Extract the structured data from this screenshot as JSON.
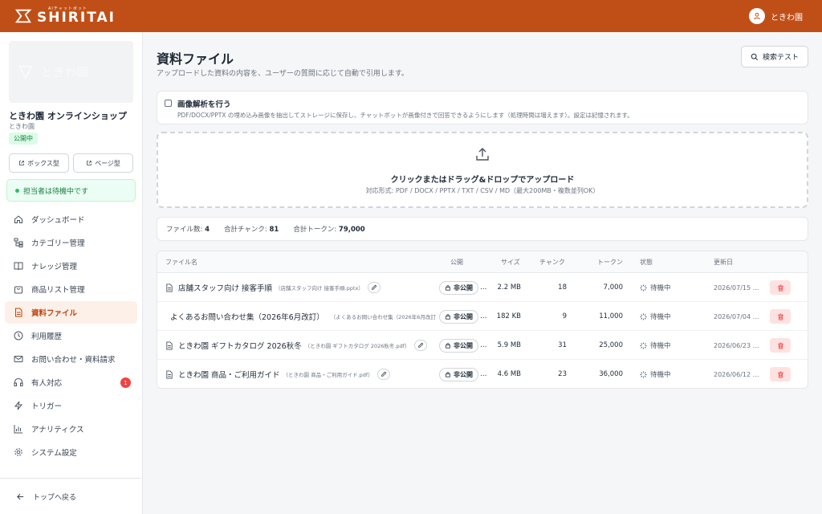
{
  "header": {
    "logo_sub": "AIチャットボット",
    "logo_text": "SHIRITAI",
    "user_name": "ときわ園"
  },
  "sidebar": {
    "brand_image_text": "ときわ園",
    "shop_name": "ときわ園 オンラインショップ",
    "shop_sub": "ときわ園",
    "public_badge": "公開中",
    "box_button": "ボックス型",
    "page_button": "ページ型",
    "status": "担当者は待機中です",
    "items": [
      {
        "label": "ダッシュボード",
        "icon": "home-icon"
      },
      {
        "label": "カテゴリー管理",
        "icon": "category-icon"
      },
      {
        "label": "ナレッジ管理",
        "icon": "book-icon"
      },
      {
        "label": "商品リスト管理",
        "icon": "shopping-bag-icon"
      },
      {
        "label": "資料ファイル",
        "icon": "file-icon",
        "active": true
      },
      {
        "label": "利用履歴",
        "icon": "clock-icon"
      },
      {
        "label": "お問い合わせ・資料請求",
        "icon": "mail-icon"
      },
      {
        "label": "有人対応",
        "icon": "headphones-icon",
        "badge": "1"
      },
      {
        "label": "トリガー",
        "icon": "zap-icon"
      },
      {
        "label": "アナリティクス",
        "icon": "bar-chart-icon"
      },
      {
        "label": "システム設定",
        "icon": "gear-icon"
      }
    ],
    "back_label": "トップへ戻る"
  },
  "main": {
    "title": "資料ファイル",
    "description": "アップロードした資料の内容を、ユーザーの質問に応じて自動で引用します。",
    "search_test": "検索テスト",
    "image_analysis": {
      "label": "画像解析を行う",
      "description": "PDF/DOCX/PPTX の埋め込み画像を抽出してストレージに保存し、チャットボットが画像付きで回答できるようにします（処理時間は増えます）。設定は記憶されます。"
    },
    "upload": {
      "title": "クリックまたはドラッグ&ドロップでアップロード",
      "formats": "対応形式: PDF / DOCX / PPTX / TXT / CSV / MD（最大200MB・複数並列OK）"
    },
    "stats": {
      "files_label": "ファイル数:",
      "files": "4",
      "chunks_label": "合計チャンク:",
      "chunks": "81",
      "tokens_label": "合計トークン:",
      "tokens": "79,000"
    },
    "table": {
      "headers": {
        "name": "ファイル名",
        "public": "公開",
        "size": "サイズ",
        "chunks": "チャンク",
        "tokens": "トークン",
        "status": "状態",
        "updated": "更新日"
      },
      "rows": [
        {
          "name": "店舗スタッフ向け 接客手順",
          "file": "（店舗スタッフ向け 接客手順.pptx）",
          "public": "非公開",
          "size": "2.2 MB",
          "chunks": "18",
          "tokens": "7,000",
          "status": "待機中",
          "updated": "2026/07/15 …",
          "has_icon": true
        },
        {
          "name": "よくあるお問い合わせ集（2026年6月改訂）",
          "file": "（よくあるお問い合わせ集（2026年6月改訂",
          "public": "非公開",
          "size": "182 KB",
          "chunks": "9",
          "tokens": "11,000",
          "status": "待機中",
          "updated": "2026/07/04 …",
          "has_icon": false
        },
        {
          "name": "ときわ園 ギフトカタログ 2026秋冬",
          "file": "（ときわ園 ギフトカタログ 2026秋冬.pdf）",
          "public": "非公開",
          "size": "5.9 MB",
          "chunks": "31",
          "tokens": "25,000",
          "status": "待機中",
          "updated": "2026/06/23 …",
          "has_icon": true
        },
        {
          "name": "ときわ園 商品・ご利用ガイド",
          "file": "（ときわ園 商品・ご利用ガイド.pdf）",
          "public": "非公開",
          "size": "4.6 MB",
          "chunks": "23",
          "tokens": "36,000",
          "status": "待機中",
          "updated": "2026/06/12 …",
          "has_icon": true
        }
      ]
    }
  },
  "colors": {
    "brand": "#c04f17",
    "active_bg": "#fdf0e8",
    "success": "#22c55e",
    "danger": "#ef4444"
  }
}
